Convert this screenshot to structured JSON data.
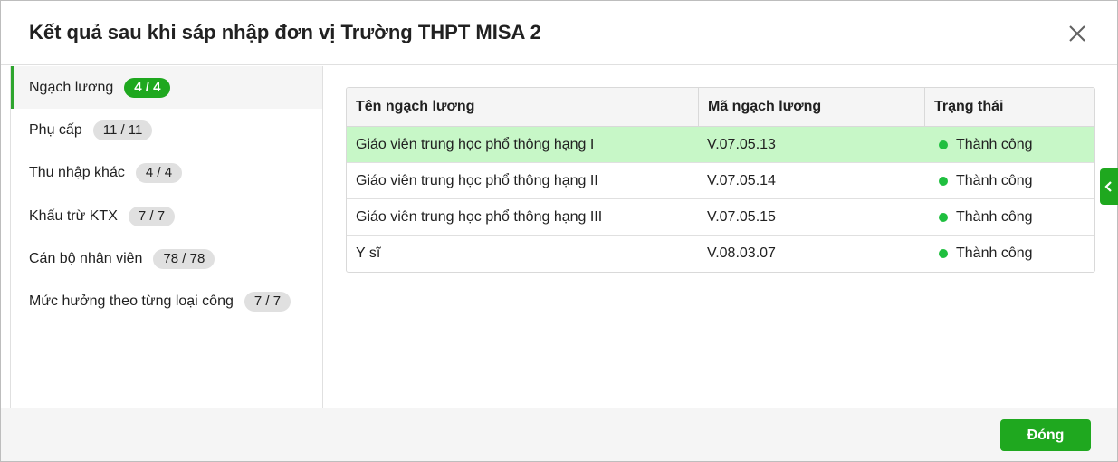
{
  "dialog": {
    "title": "Kết quả sau khi sáp nhập đơn vị Trường THPT MISA 2",
    "close_icon": "close-icon"
  },
  "sidebar": {
    "items": [
      {
        "label": "Ngạch lương",
        "count": "4 / 4",
        "active": true
      },
      {
        "label": "Phụ cấp",
        "count": "11 / 11",
        "active": false
      },
      {
        "label": "Thu nhập khác",
        "count": "4 / 4",
        "active": false
      },
      {
        "label": "Khấu trừ KTX",
        "count": "7 / 7",
        "active": false
      },
      {
        "label": "Cán bộ nhân viên",
        "count": "78 / 78",
        "active": false
      },
      {
        "label": "Mức hưởng theo từng loại công",
        "count": "7 / 7",
        "active": false
      }
    ]
  },
  "table": {
    "columns": [
      "Tên ngạch lương",
      "Mã ngạch lương",
      "Trạng thái"
    ],
    "rows": [
      {
        "name": "Giáo viên trung học phổ thông hạng I",
        "code": "V.07.05.13",
        "status": "Thành công",
        "selected": true
      },
      {
        "name": "Giáo viên trung học phổ thông hạng II",
        "code": "V.07.05.14",
        "status": "Thành công",
        "selected": false
      },
      {
        "name": "Giáo viên trung học phổ thông hạng III",
        "code": "V.07.05.15",
        "status": "Thành công",
        "selected": false
      },
      {
        "name": "Y sĩ",
        "code": "V.08.03.07",
        "status": "Thành công",
        "selected": false
      }
    ]
  },
  "side_toggle": {
    "icon": "chevron-left-icon"
  },
  "footer": {
    "close_label": "Đóng"
  },
  "colors": {
    "accent": "#1fa81f",
    "selected_row": "#c7f7c7",
    "status_success": "#1fbf3f"
  }
}
